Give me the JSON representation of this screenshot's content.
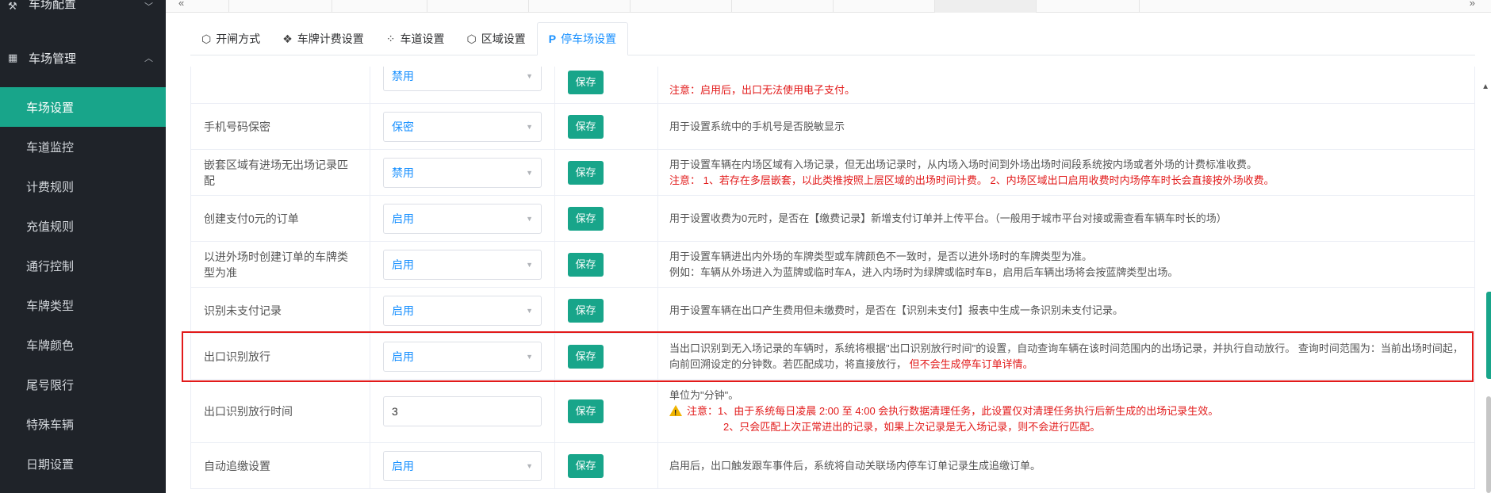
{
  "sidebar": {
    "group_top": "车场配置",
    "group_main": "车场管理",
    "items": [
      {
        "label": "车场设置",
        "active": true
      },
      {
        "label": "车道监控"
      },
      {
        "label": "计费规则"
      },
      {
        "label": "充值规则"
      },
      {
        "label": "通行控制"
      },
      {
        "label": "车牌类型"
      },
      {
        "label": "车牌颜色"
      },
      {
        "label": "尾号限行"
      },
      {
        "label": "特殊车辆"
      },
      {
        "label": "日期设置"
      }
    ]
  },
  "subtabs": [
    {
      "label": "开闸方式",
      "icon": "cube-icon"
    },
    {
      "label": "车牌计费设置",
      "icon": "layers-icon"
    },
    {
      "label": "车道设置",
      "icon": "nodes-icon"
    },
    {
      "label": "区域设置",
      "icon": "box-icon"
    },
    {
      "label": "停车场设置",
      "icon": "parking-icon",
      "active": true
    }
  ],
  "save_label": "保存",
  "rows": [
    {
      "name": "",
      "value": "禁用",
      "desc": [],
      "desc_red": "注意：启用后，出口无法使用电子支付。"
    },
    {
      "name": "手机号码保密",
      "value": "保密",
      "desc": [
        "用于设置系统中的手机号是否脱敏显示"
      ]
    },
    {
      "name": "嵌套区域有进场无出场记录匹配",
      "value": "禁用",
      "desc": [
        "用于设置车辆在内场区域有入场记录，但无出场记录时，从内场入场时间到外场出场时间段系统按内场或者外场的计费标准收费。"
      ],
      "desc_red": "注意： 1、若存在多层嵌套，以此类推按照上层区域的出场时间计费。 2、内场区域出口启用收费时内场停车时长会直接按外场收费。"
    },
    {
      "name": "创建支付0元的订单",
      "value": "启用",
      "desc": [
        "用于设置收费为0元时，是否在【缴费记录】新增支付订单并上传平台。（一般用于城市平台对接或需查看车辆车时长的场）"
      ]
    },
    {
      "name": "以进外场时创建订单的车牌类型为准",
      "value": "启用",
      "desc": [
        "用于设置车辆进出内外场的车牌类型或车牌颜色不一致时，是否以进外场时的车牌类型为准。",
        "例如：车辆从外场进入为蓝牌或临时车A，进入内场时为绿牌或临时车B，启用后车辆出场将会按蓝牌类型出场。"
      ]
    },
    {
      "name": "识别未支付记录",
      "value": "启用",
      "desc": [
        "用于设置车辆在出口产生费用但未缴费时，是否在【识别未支付】报表中生成一条识别未支付记录。"
      ]
    },
    {
      "name": "出口识别放行",
      "value": "启用",
      "desc": [
        "当出口识别到无入场记录的车辆时，系统将根据\"出口识别放行时间\"的设置，自动查询车辆在该时间范围内的出场记录，并执行自动放行。 查询时间范围为：当前出场时间起，向前回溯设定的分钟数。若匹配成功，将直接放行，"
      ],
      "desc_red_inline": "但不会生成停车订单详情。"
    },
    {
      "name": "出口识别放行时间",
      "value": "3",
      "desc": [
        "单位为\"分钟\"。"
      ],
      "warn_1": "注意：1、由于系统每日凌晨 2:00 至 4:00 会执行数据清理任务，此设置仅对清理任务执行后新生成的出场记录生效。",
      "warn_2": "2、只会匹配上次正常进出的记录，如果上次记录是无入场记录，则不会进行匹配。"
    },
    {
      "name": "自动追缴设置",
      "value": "启用",
      "desc": [
        "启用后，出口触发跟车事件后，系统将自动关联场内停车订单记录生成追缴订单。"
      ]
    }
  ]
}
